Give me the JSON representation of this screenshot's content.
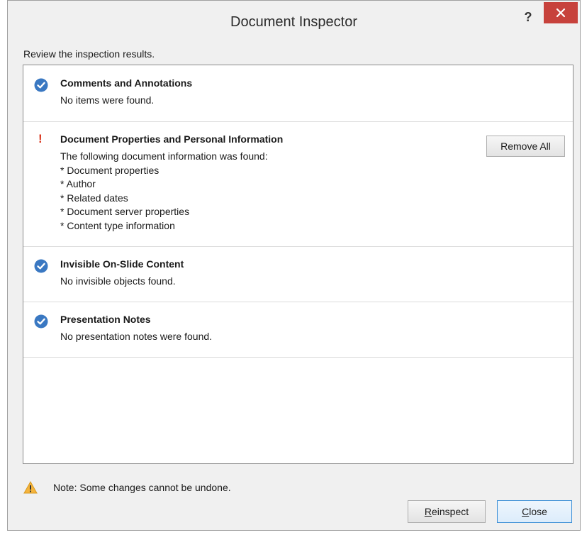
{
  "window": {
    "title": "Document Inspector",
    "help_label": "?",
    "close_label": "✕"
  },
  "instruction": "Review the inspection results.",
  "sections": [
    {
      "title": "Comments and Annotations",
      "status": "check-circle-icon",
      "lines": [
        "No items were found."
      ]
    },
    {
      "title": "Document Properties and Personal Information",
      "status": "warning-exclamation-icon",
      "lines": [
        "The following document information was found:",
        "* Document properties",
        "* Author",
        "* Related dates",
        "* Document server properties",
        "* Content type information"
      ],
      "action_label": "Remove All"
    },
    {
      "title": "Invisible On-Slide Content",
      "status": "check-circle-icon",
      "lines": [
        "No invisible objects found."
      ]
    },
    {
      "title": "Presentation Notes",
      "status": "check-circle-icon",
      "lines": [
        "No presentation notes were found."
      ]
    }
  ],
  "footer": {
    "note": "Note: Some changes cannot be undone.",
    "reinspect_label": "Reinspect",
    "reinspect_rest": "einspect",
    "reinspect_accel": "R",
    "close_label": "Close",
    "close_rest": "lose",
    "close_accel": "C"
  },
  "colors": {
    "check": "#3a78c2",
    "warning": "#d9371f",
    "close_button": "#c7423c",
    "primary_border": "#3c8fd6"
  }
}
